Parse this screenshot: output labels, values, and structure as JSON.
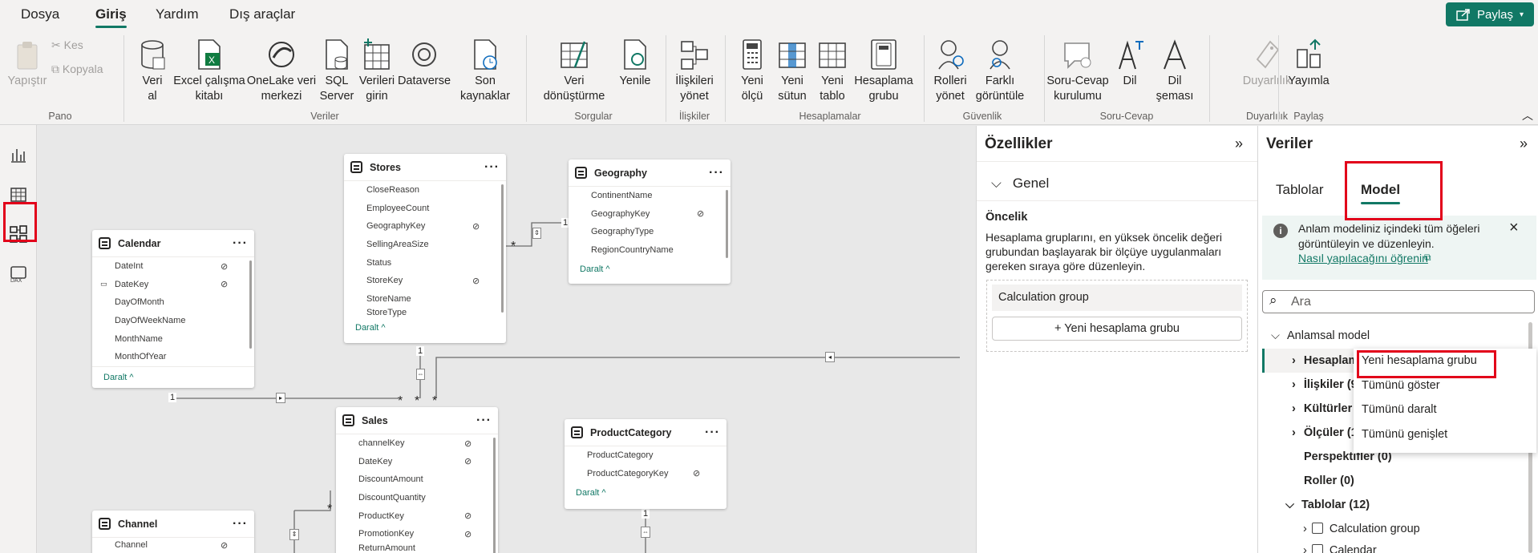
{
  "menu_tabs": [
    "Dosya",
    "Giriş",
    "Yardım",
    "Dış araçlar"
  ],
  "share_label": "Paylaş",
  "ribbon": {
    "pano": {
      "paste": "Yapıştır",
      "cut": "Kes",
      "copy": "Kopyala",
      "group": "Pano"
    },
    "veriler": {
      "items": [
        "Veri al",
        "Excel çalışma kitabı",
        "OneLake veri merkezi",
        "SQL Server",
        "Verileri girin",
        "Dataverse",
        "Son kaynaklar"
      ],
      "group": "Veriler"
    },
    "sorgular": {
      "items": [
        "Veri dönüştürme",
        "Yenile"
      ],
      "group": "Sorgular"
    },
    "iliskiler": {
      "items": [
        "İlişkileri yönet"
      ],
      "group": "İlişkiler"
    },
    "hesaplamalar": {
      "items": [
        "Yeni ölçü",
        "Yeni sütun",
        "Yeni tablo",
        "Hesaplama grubu"
      ],
      "group": "Hesaplamalar"
    },
    "guvenlik": {
      "items": [
        "Rolleri yönet",
        "Farklı görüntüle"
      ],
      "group": "Güvenlik"
    },
    "soru": {
      "items": [
        "Soru-Cevap kurulumu",
        "Dil",
        "Dil şeması"
      ],
      "group": "Soru-Cevap"
    },
    "duyarlilik": {
      "items": [
        "Duyarlılık"
      ],
      "group": "Duyarlılık"
    },
    "paylas": {
      "items": [
        "Yayımla"
      ],
      "group": "Paylaş"
    }
  },
  "tables": {
    "stores": {
      "name": "Stores",
      "fields": [
        "CloseReason",
        "EmployeeCount",
        "GeographyKey",
        "SellingAreaSize",
        "Status",
        "StoreKey",
        "StoreName",
        "StoreType"
      ],
      "collapse": "Daralt"
    },
    "geography": {
      "name": "Geography",
      "fields": [
        "ContinentName",
        "GeographyKey",
        "GeographyType",
        "RegionCountryName"
      ],
      "collapse": "Daralt"
    },
    "calendar": {
      "name": "Calendar",
      "fields": [
        "DateInt",
        "DateKey",
        "DayOfMonth",
        "DayOfWeekName",
        "MonthName",
        "MonthOfYear"
      ],
      "collapse": "Daralt"
    },
    "sales": {
      "name": "Sales",
      "fields": [
        "channelKey",
        "DateKey",
        "DiscountAmount",
        "DiscountQuantity",
        "ProductKey",
        "PromotionKey",
        "ReturnAmount"
      ]
    },
    "productcategory": {
      "name": "ProductCategory",
      "fields": [
        "ProductCategory",
        "ProductCategoryKey"
      ],
      "collapse": "Daralt"
    },
    "channel": {
      "name": "Channel",
      "fields": [
        "Channel"
      ]
    }
  },
  "rel_labels": {
    "one": "1",
    "many": "*"
  },
  "properties": {
    "title": "Özellikler",
    "section": "Genel",
    "heading": "Öncelik",
    "description": "Hesaplama gruplarını, en yüksek öncelik değeri grubundan başlayarak bir ölçüye uygulanmaları gereken sıraya göre düzenleyin.",
    "item": "Calculation group",
    "add_button": "+ Yeni hesaplama grubu"
  },
  "data_pane": {
    "title": "Veriler",
    "tabs": [
      "Tablolar",
      "Model"
    ],
    "info": "Anlam modeliniz içindeki tüm öğeleri görüntüleyin ve düzenleyin.",
    "info_link": "Nasıl yapılacağını öğrenin",
    "search_placeholder": "Ara",
    "tree": {
      "root": "Anlamsal model",
      "items": [
        "Hesaplam",
        "İlişkiler (9",
        "Kültürler",
        "Ölçüler (1",
        "Perspektifler (0)",
        "Roller (0)",
        "Tablolar (12)"
      ],
      "sub": [
        "Calculation group",
        "Calendar"
      ]
    }
  },
  "context_menu": [
    "Yeni hesaplama grubu",
    "Tümünü göster",
    "Tümünü daralt",
    "Tümünü genişlet"
  ],
  "colors": {
    "accent": "#117865",
    "highlight": "#e2001a"
  }
}
